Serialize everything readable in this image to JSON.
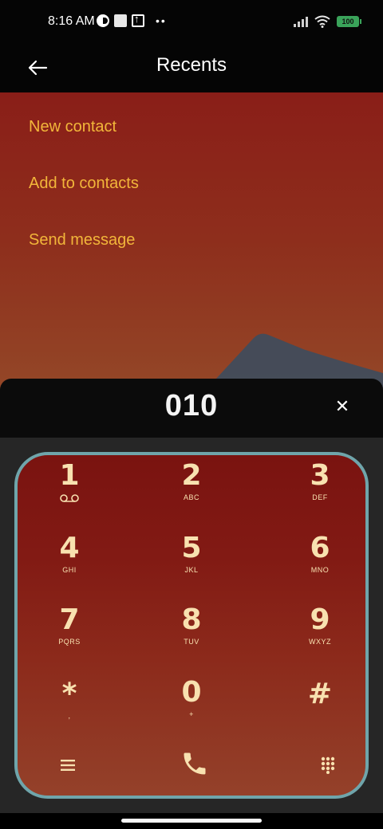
{
  "status_bar": {
    "time": "8:16 AM",
    "battery": "100",
    "left_icons": [
      "app-notification-icon",
      "square-notification-icon",
      "upload-icon",
      "more-dots-icon"
    ],
    "right_icons": [
      "signal-icon",
      "wifi-icon",
      "battery-icon"
    ]
  },
  "app_bar": {
    "title": "Recents",
    "back_icon": "arrow-left-icon"
  },
  "actions": {
    "new_contact": "New contact",
    "add_to_contacts": "Add to contacts",
    "send_message": "Send message"
  },
  "dialer": {
    "number": "010",
    "clear_icon": "close-icon"
  },
  "keypad": {
    "keys": [
      {
        "digit": "1",
        "letters": ""
      },
      {
        "digit": "2",
        "letters": "ABC"
      },
      {
        "digit": "3",
        "letters": "DEF"
      },
      {
        "digit": "4",
        "letters": "GHI"
      },
      {
        "digit": "5",
        "letters": "JKL"
      },
      {
        "digit": "6",
        "letters": "MNO"
      },
      {
        "digit": "7",
        "letters": "PQRS"
      },
      {
        "digit": "8",
        "letters": "TUV"
      },
      {
        "digit": "9",
        "letters": "WXYZ"
      },
      {
        "digit": "*",
        "letters": ","
      },
      {
        "digit": "0",
        "letters": "+"
      },
      {
        "digit": "#",
        "letters": ""
      }
    ],
    "bottom": [
      "menu-icon",
      "phone-call-icon",
      "dialpad-icon"
    ]
  },
  "colors": {
    "accent_text": "#f2b63a",
    "keypad_border": "#6fa5ab",
    "key_text": "#f8e1b0"
  }
}
